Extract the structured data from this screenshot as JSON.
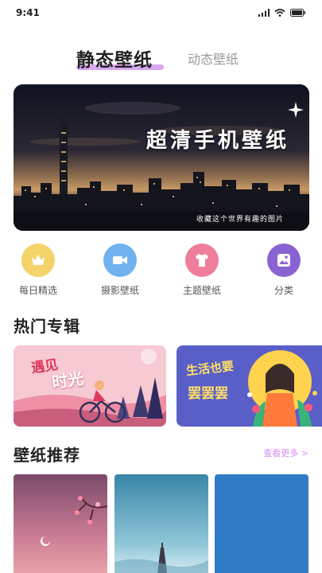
{
  "status": {
    "time": "9:41"
  },
  "tabs": {
    "active": "静态壁纸",
    "inactive": "动态壁纸"
  },
  "banner": {
    "title": "超清手机壁纸",
    "subtitle": "收藏这个世界有趣的图片"
  },
  "quick_actions": [
    {
      "label": "每日精选",
      "icon": "crown-icon",
      "color": "#f5d36b"
    },
    {
      "label": "摄影壁纸",
      "icon": "video-camera-icon",
      "color": "#6fb2ee"
    },
    {
      "label": "主题壁纸",
      "icon": "tshirt-icon",
      "color": "#ee7e9c"
    },
    {
      "label": "分类",
      "icon": "gallery-icon",
      "color": "#8a63d2"
    }
  ],
  "sections": {
    "hot_albums": "热门专辑",
    "recommend": "壁纸推荐"
  },
  "albums": [
    {
      "title_line1": "遇见",
      "title_line2": "时光"
    },
    {
      "title_line1": "生活也要",
      "title_line2": "罢罢罢"
    }
  ],
  "more_label": "查看更多 >",
  "colors": {
    "accent": "#d9a8f0",
    "link": "#d58cf0"
  }
}
